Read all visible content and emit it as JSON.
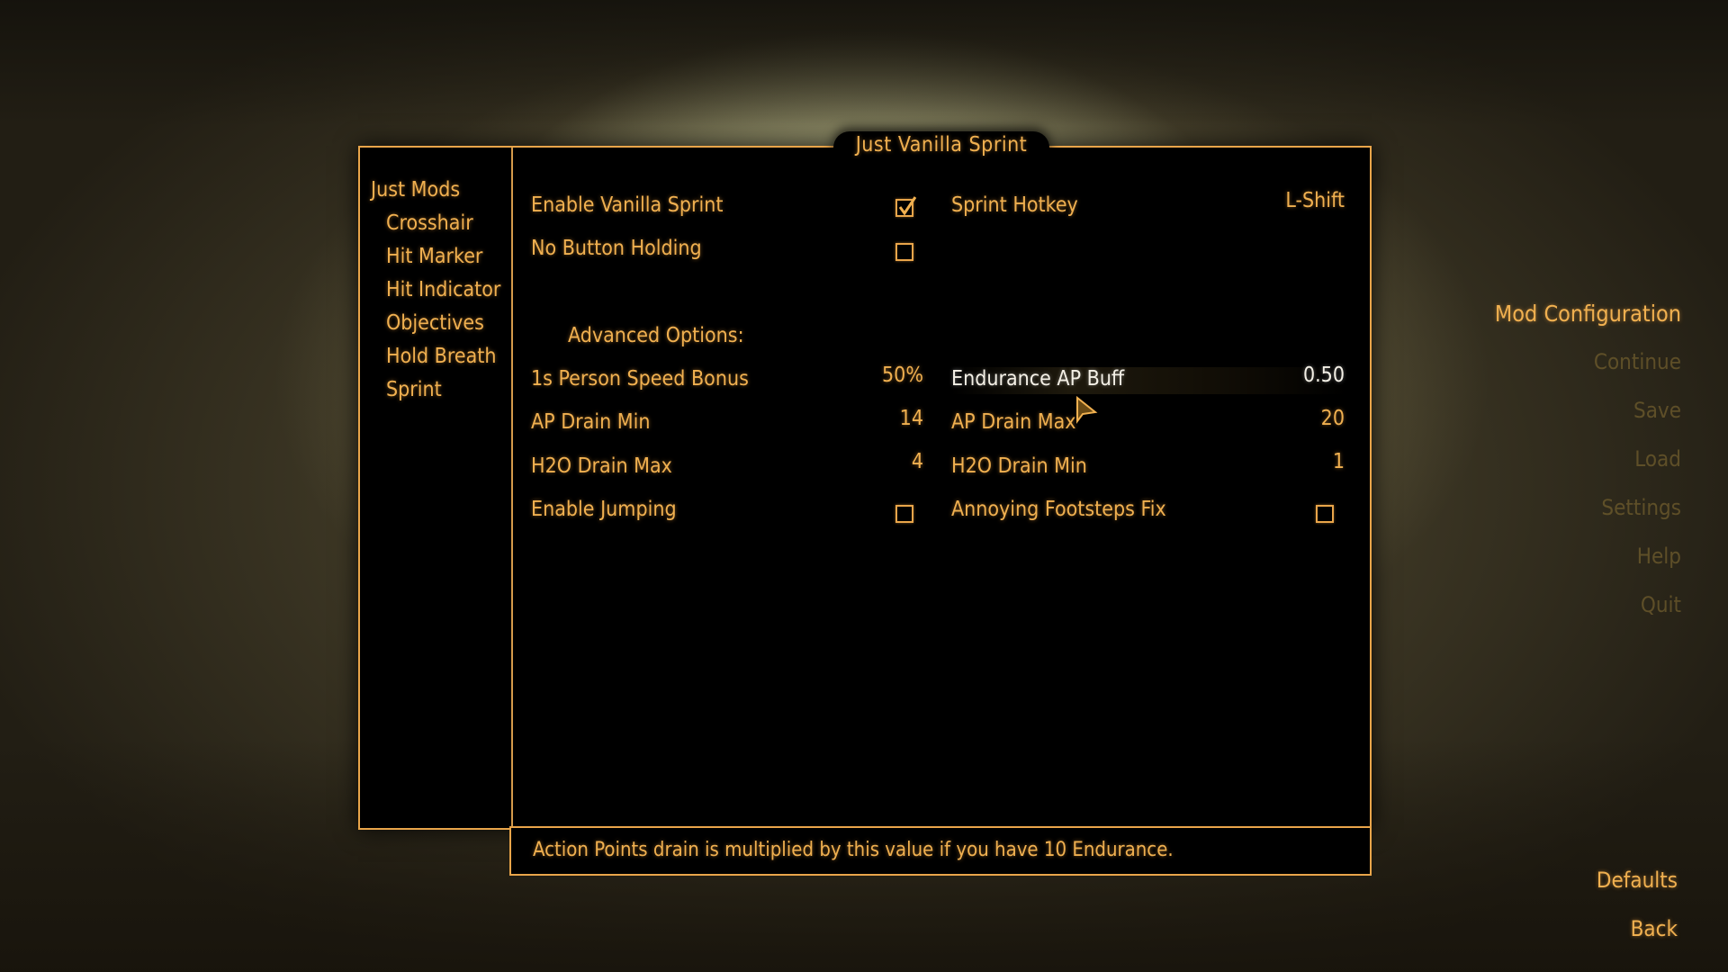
{
  "window": {
    "title": "Just Vanilla Sprint"
  },
  "sidebar": {
    "header": "Just Mods",
    "items": [
      {
        "label": "Crosshair"
      },
      {
        "label": "Hit Marker"
      },
      {
        "label": "Hit Indicator"
      },
      {
        "label": "Objectives"
      },
      {
        "label": "Hold Breath"
      },
      {
        "label": "Sprint"
      }
    ]
  },
  "settings": {
    "enable_vanilla_sprint": {
      "label": "Enable Vanilla Sprint",
      "checked": true
    },
    "no_button_holding": {
      "label": "No Button Holding",
      "checked": false
    },
    "sprint_hotkey": {
      "label": "Sprint Hotkey",
      "value": "L-Shift"
    },
    "advanced_header": "Advanced Options:",
    "first_person_speed_bonus": {
      "label": "1s Person Speed Bonus",
      "value": "50%"
    },
    "endurance_ap_buff": {
      "label": "Endurance AP Buff",
      "value": "0.50",
      "selected": true
    },
    "ap_drain_min": {
      "label": "AP Drain Min",
      "value": "14"
    },
    "ap_drain_max": {
      "label": "AP Drain Max",
      "value": "20"
    },
    "h2o_drain_max": {
      "label": "H2O Drain Max",
      "value": "4"
    },
    "h2o_drain_min": {
      "label": "H2O Drain Min",
      "value": "1"
    },
    "enable_jumping": {
      "label": "Enable Jumping",
      "checked": false
    },
    "annoying_footsteps_fix": {
      "label": "Annoying Footsteps Fix",
      "checked": false
    }
  },
  "help_text": "Action Points drain is multiplied by this value if you have 10 Endurance.",
  "pause_menu": {
    "items": [
      {
        "label": "Mod Configuration",
        "active": true
      },
      {
        "label": "Continue"
      },
      {
        "label": "Save"
      },
      {
        "label": "Load"
      },
      {
        "label": "Settings"
      },
      {
        "label": "Help"
      },
      {
        "label": "Quit"
      }
    ]
  },
  "footer": {
    "defaults_label": "Defaults",
    "back_label": "Back"
  },
  "colors": {
    "accent": "#f0b050",
    "highlight_text": "#f4f0e6",
    "panel_bg": "#000000"
  }
}
